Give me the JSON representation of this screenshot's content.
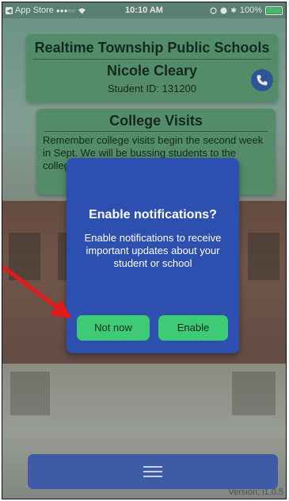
{
  "status_bar": {
    "carrier": "App Store",
    "signal": "●●●○○",
    "time": "10:10 AM",
    "battery": "100%"
  },
  "header": {
    "school": "Realtime Township Public Schools",
    "student_name": "Nicole Cleary",
    "student_id": "Student ID: 131200"
  },
  "news": {
    "title": "College Visits",
    "body": "Remember college visits begin the second week in Sept. We will be bussing students to the colleges every Friday until December."
  },
  "modal": {
    "title": "Enable notifications?",
    "message": "Enable notifications to receive important updates about your student or school",
    "not_now_label": "Not now",
    "enable_label": "Enable"
  },
  "footer": {
    "version": "Version: i1.0.5"
  },
  "colors": {
    "card_green": "#5a9a73",
    "modal_blue": "#2d4fb0",
    "button_green": "#3ecb75",
    "nav_blue": "#3d5ba7",
    "arrow_red": "#e01b1b"
  },
  "icons": {
    "phone": "phone-icon",
    "menu": "hamburger-menu-icon"
  }
}
